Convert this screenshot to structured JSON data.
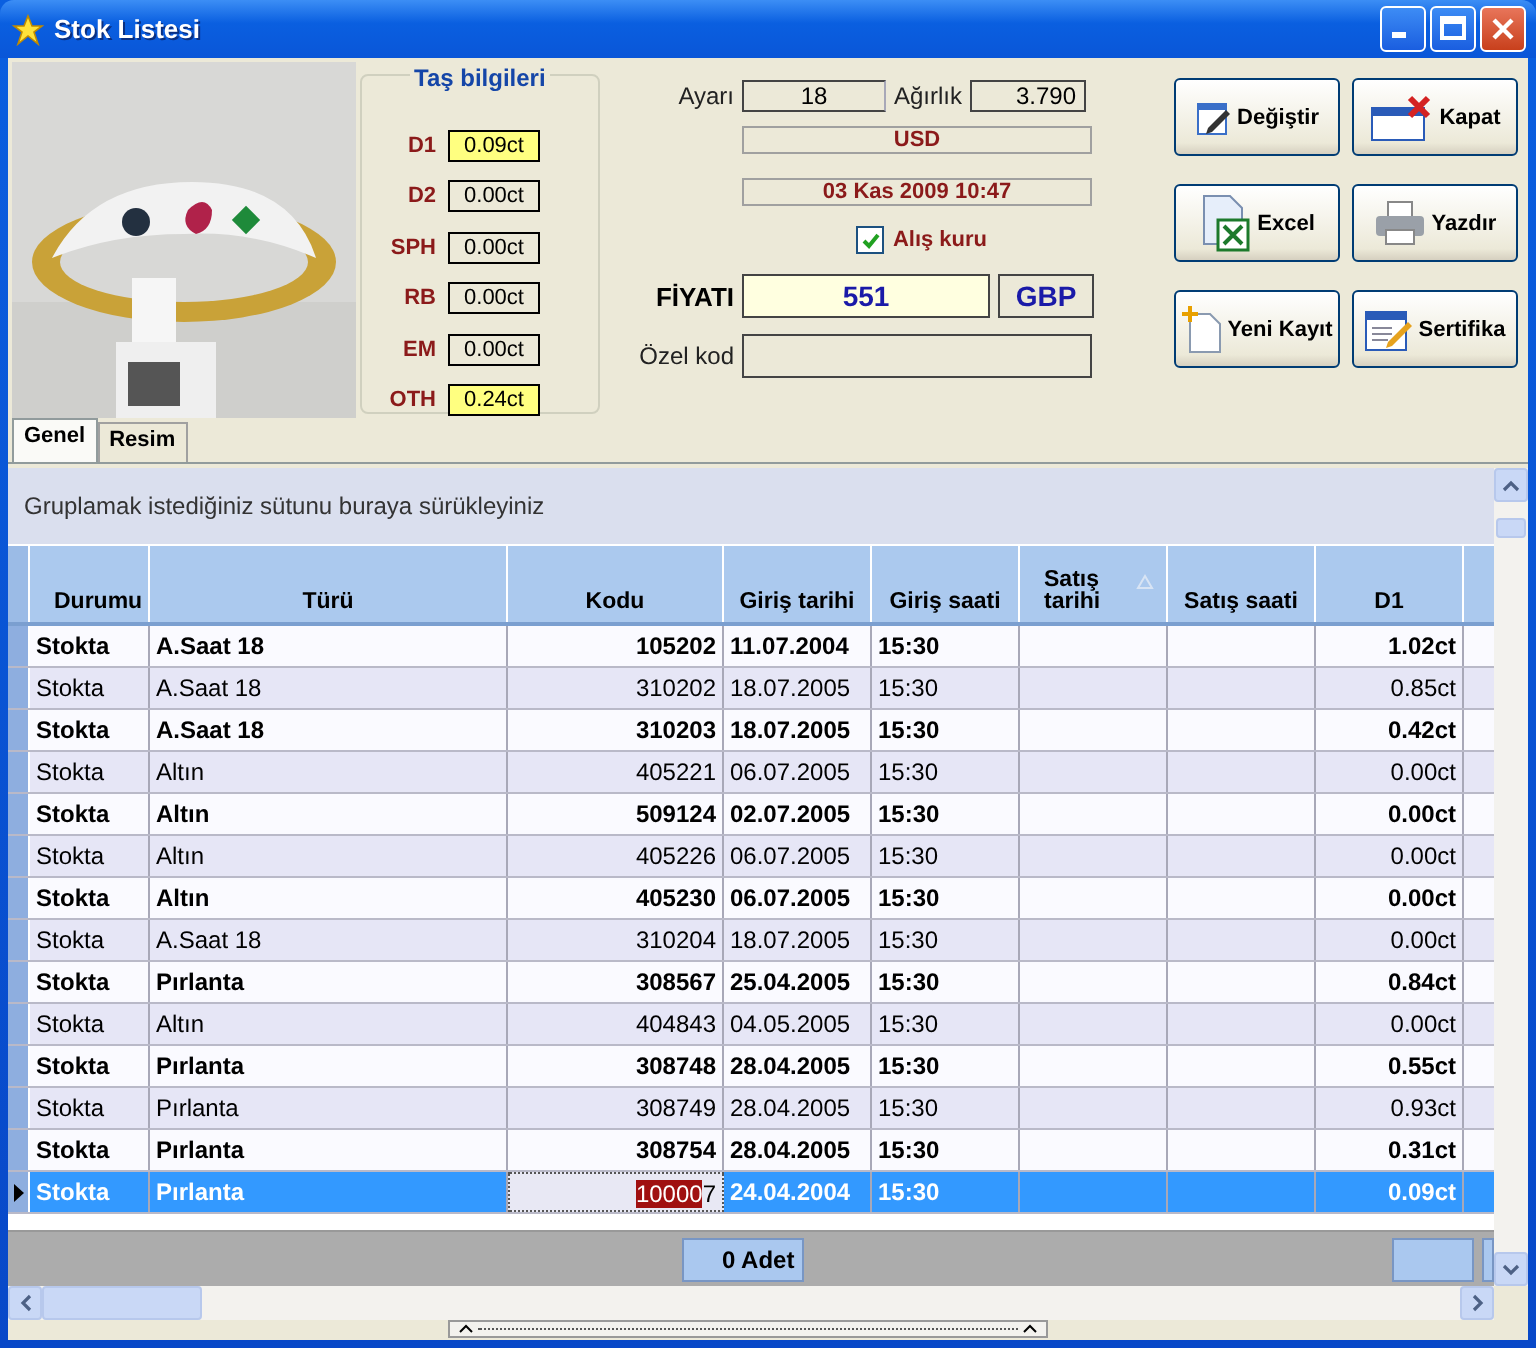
{
  "window": {
    "title": "Stok Listesi"
  },
  "stones": {
    "title": "Taş bilgileri",
    "items": [
      {
        "label": "D1",
        "value": "0.09ct",
        "highlighted": true
      },
      {
        "label": "D2",
        "value": "0.00ct",
        "highlighted": false
      },
      {
        "label": "SPH",
        "value": "0.00ct",
        "highlighted": false
      },
      {
        "label": "RB",
        "value": "0.00ct",
        "highlighted": false
      },
      {
        "label": "EM",
        "value": "0.00ct",
        "highlighted": false
      },
      {
        "label": "OTH",
        "value": "0.24ct",
        "highlighted": true
      }
    ]
  },
  "details": {
    "ayari_label": "Ayarı",
    "ayari": "18",
    "agirlik_label": "Ağırlık",
    "agirlik": "3.790",
    "currency": "USD",
    "date": "03 Kas 2009 10:47",
    "alis_kuru": {
      "label": "Alış kuru",
      "checked": true
    },
    "fiyati_label": "FİYATI",
    "fiyati": "551",
    "fiyat_currency": "GBP",
    "ozel_kod_label": "Özel kod"
  },
  "buttons": [
    {
      "label": "Değiştir",
      "kind": "edit"
    },
    {
      "label": "Kapat",
      "kind": "close"
    },
    {
      "label": "Excel",
      "kind": "excel"
    },
    {
      "label": "Yazdır",
      "kind": "print"
    },
    {
      "label": "Yeni Kayıt",
      "kind": "new"
    },
    {
      "label": "Sertifika",
      "kind": "certificate"
    }
  ],
  "tabs": [
    {
      "label": "Genel",
      "selected": true
    },
    {
      "label": "Resim",
      "selected": false
    }
  ],
  "grid": {
    "group_hint": "Gruplamak istediğiniz sütunu buraya sürükleyiniz",
    "columns": [
      {
        "label": "Durumu",
        "sorted": false
      },
      {
        "label": "Türü",
        "sorted": false
      },
      {
        "label": "Kodu",
        "sorted": false
      },
      {
        "label": "Giriş tarihi",
        "sorted": false
      },
      {
        "label": "Giriş saati",
        "sorted": false
      },
      {
        "label": "Satış tarihi",
        "sorted": true
      },
      {
        "label": "Satış saati",
        "sorted": false
      },
      {
        "label": "D1",
        "sorted": false
      }
    ],
    "rows": [
      {
        "durumu": "Stokta",
        "turu": "A.Saat 18",
        "kodu": "105202",
        "giris_tarihi": "11.07.2004",
        "giris_saati": "15:30",
        "d1": "1.02ct",
        "bold": true,
        "selected": false
      },
      {
        "durumu": "Stokta",
        "turu": "A.Saat 18",
        "kodu": "310202",
        "giris_tarihi": "18.07.2005",
        "giris_saati": "15:30",
        "d1": "0.85ct",
        "bold": false,
        "selected": false
      },
      {
        "durumu": "Stokta",
        "turu": "A.Saat 18",
        "kodu": "310203",
        "giris_tarihi": "18.07.2005",
        "giris_saati": "15:30",
        "d1": "0.42ct",
        "bold": true,
        "selected": false
      },
      {
        "durumu": "Stokta",
        "turu": "Altın",
        "kodu": "405221",
        "giris_tarihi": "06.07.2005",
        "giris_saati": "15:30",
        "d1": "0.00ct",
        "bold": false,
        "selected": false
      },
      {
        "durumu": "Stokta",
        "turu": "Altın",
        "kodu": "509124",
        "giris_tarihi": "02.07.2005",
        "giris_saati": "15:30",
        "d1": "0.00ct",
        "bold": true,
        "selected": false
      },
      {
        "durumu": "Stokta",
        "turu": "Altın",
        "kodu": "405226",
        "giris_tarihi": "06.07.2005",
        "giris_saati": "15:30",
        "d1": "0.00ct",
        "bold": false,
        "selected": false
      },
      {
        "durumu": "Stokta",
        "turu": "Altın",
        "kodu": "405230",
        "giris_tarihi": "06.07.2005",
        "giris_saati": "15:30",
        "d1": "0.00ct",
        "bold": true,
        "selected": false
      },
      {
        "durumu": "Stokta",
        "turu": "A.Saat 18",
        "kodu": "310204",
        "giris_tarihi": "18.07.2005",
        "giris_saati": "15:30",
        "d1": "0.00ct",
        "bold": false,
        "selected": false
      },
      {
        "durumu": "Stokta",
        "turu": "Pırlanta",
        "kodu": "308567",
        "giris_tarihi": "25.04.2005",
        "giris_saati": "15:30",
        "d1": "0.84ct",
        "bold": true,
        "selected": false
      },
      {
        "durumu": "Stokta",
        "turu": "Altın",
        "kodu": "404843",
        "giris_tarihi": "04.05.2005",
        "giris_saati": "15:30",
        "d1": "0.00ct",
        "bold": false,
        "selected": false
      },
      {
        "durumu": "Stokta",
        "turu": "Pırlanta",
        "kodu": "308748",
        "giris_tarihi": "28.04.2005",
        "giris_saati": "15:30",
        "d1": "0.55ct",
        "bold": true,
        "selected": false
      },
      {
        "durumu": "Stokta",
        "turu": "Pırlanta",
        "kodu": "308749",
        "giris_tarihi": "28.04.2005",
        "giris_saati": "15:30",
        "d1": "0.93ct",
        "bold": false,
        "selected": false
      },
      {
        "durumu": "Stokta",
        "turu": "Pırlanta",
        "kodu": "308754",
        "giris_tarihi": "28.04.2005",
        "giris_saati": "15:30",
        "d1": "0.31ct",
        "bold": true,
        "selected": false
      },
      {
        "durumu": "Stokta",
        "turu": "Pırlanta",
        "kodu_edit": {
          "selected_text": "10000",
          "rest": "7"
        },
        "giris_tarihi": "24.04.2004",
        "giris_saati": "15:30",
        "d1": "0.09ct",
        "bold": true,
        "selected": true
      }
    ],
    "summary": "0 Adet"
  }
}
